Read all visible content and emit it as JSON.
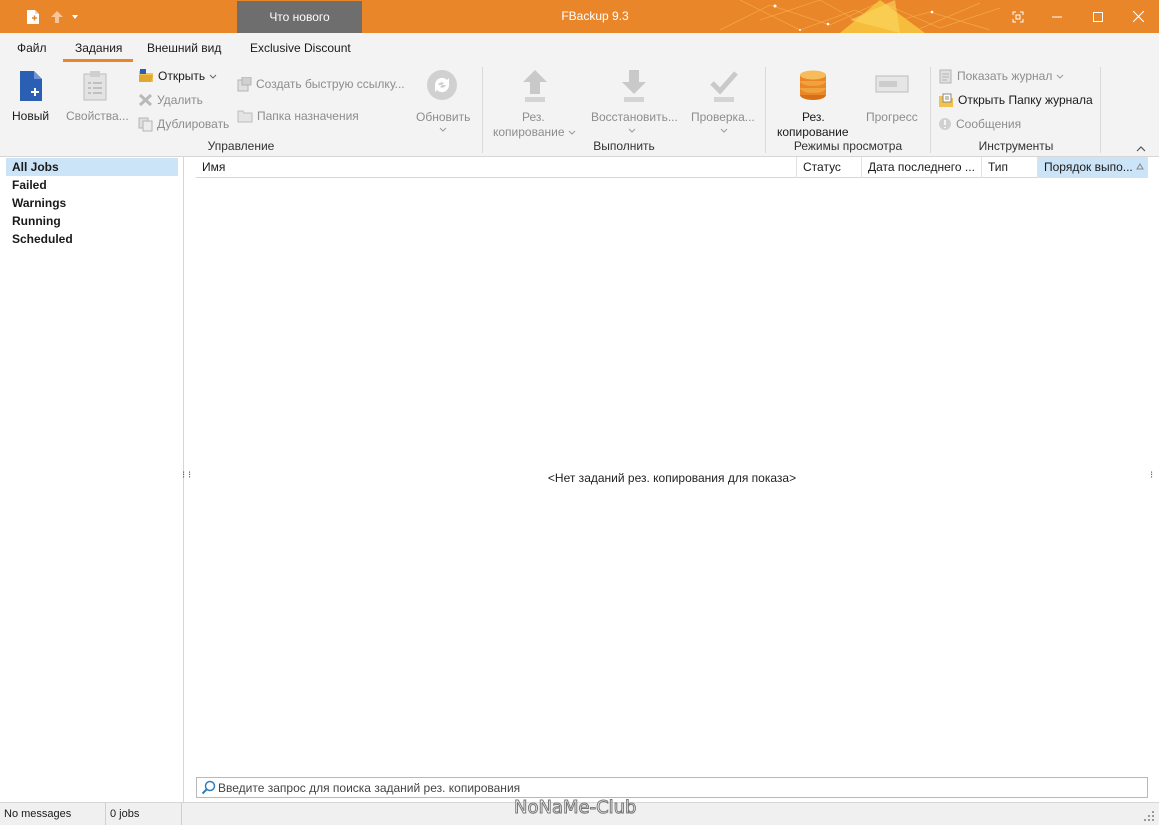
{
  "window": {
    "title": "FBackup 9.3",
    "whats_new": "Что нового",
    "accent": "#e9862a"
  },
  "tabs": [
    "Файл",
    "Задания",
    "Внешний вид",
    "Exclusive Discount"
  ],
  "ribbon": {
    "manage": {
      "new_label": "Новый",
      "properties_label": "Свойства...",
      "open_label": "Открыть",
      "delete_label": "Удалить",
      "duplicate_label": "Дублировать",
      "quicklink_label": "Создать быструю ссылку...",
      "dest_folder_label": "Папка назначения",
      "refresh_label": "Обновить",
      "group_label": "Управление"
    },
    "run": {
      "backup_label": "Рез.",
      "backup_label2": "копирование",
      "restore_label": "Восстановить...",
      "test_label": "Проверка...",
      "group_label": "Выполнить"
    },
    "view": {
      "backup_label": "Рез.",
      "backup_label2": "копирование",
      "progress_label": "Прогресс",
      "group_label": "Режимы просмотра"
    },
    "tools": {
      "show_log_label": "Показать журнал",
      "open_log_folder_label": "Открыть Папку журнала",
      "messages_label": "Сообщения",
      "group_label": "Инструменты"
    }
  },
  "filters": [
    "All Jobs",
    "Failed",
    "Warnings",
    "Running",
    "Scheduled"
  ],
  "grid": {
    "columns": [
      "Имя",
      "Статус",
      "Дата последнего ...",
      "Тип",
      "Порядок выпо..."
    ],
    "empty_message": "<Нет заданий рез. копирования для показа>"
  },
  "search": {
    "placeholder": "Введите запрос для поиска заданий рез. копирования"
  },
  "status": {
    "messages": "No messages",
    "jobs": "0 jobs"
  },
  "watermark": "NoNaMe-Club"
}
